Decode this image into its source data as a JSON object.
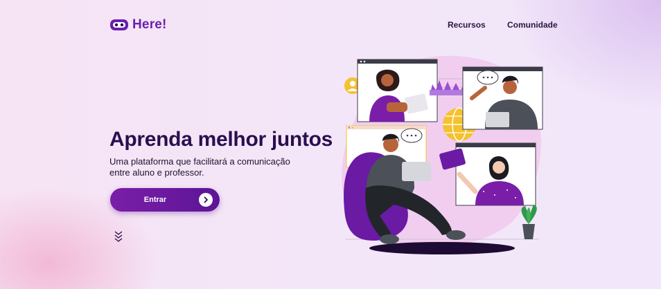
{
  "brand": {
    "name": "Here!",
    "color": "#6a1fb0",
    "icon": "robot-face-icon"
  },
  "nav": {
    "items": [
      {
        "label": "Recursos"
      },
      {
        "label": "Comunidade"
      }
    ]
  },
  "hero": {
    "title": "Aprenda melhor juntos",
    "subtitle_line1": "Uma plataforma que facilitará a comunicação",
    "subtitle_line2": "entre aluno e professor.",
    "cta_label": "Entrar",
    "cta_icon": "chevron-right-icon",
    "scroll_icon": "double-chevron-down-icon"
  },
  "colors": {
    "accent": "#6b1aa4",
    "dark_text": "#2a0f4f",
    "background": "#f4e5f6",
    "highlight": "#f5c12e"
  }
}
